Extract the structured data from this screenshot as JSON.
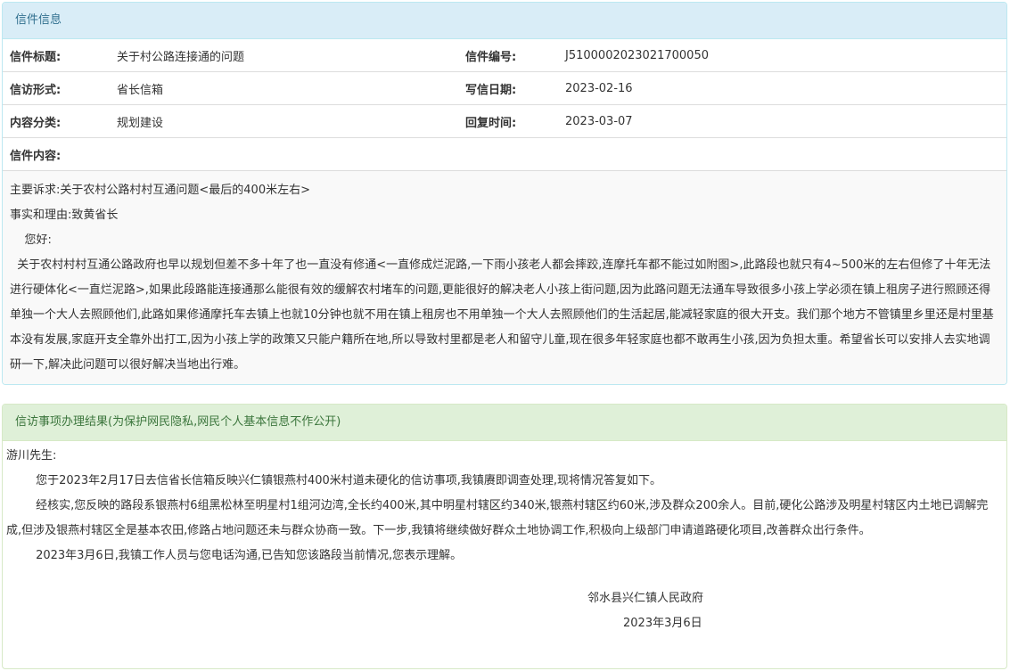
{
  "letter_panel": {
    "title": "信件信息",
    "fields": {
      "subject_label": "信件标题:",
      "subject_value": "关于村公路连接通的问题",
      "number_label": "信件编号:",
      "number_value": "J5100002023021700050",
      "form_label": "信访形式:",
      "form_value": "省长信箱",
      "write_date_label": "写信日期:",
      "write_date_value": "2023-02-16",
      "category_label": "内容分类:",
      "category_value": "规划建设",
      "reply_time_label": "回复时间:",
      "reply_time_value": "2023-03-07",
      "content_label": "信件内容:"
    },
    "content": [
      "主要诉求:关于农村公路村村互通问题<最后的400米左右>",
      "事实和理由:致黄省长",
      "    您好:",
      "  关于农村村村互通公路政府也早以规划但差不多十年了也一直没有修通<一直修成烂泥路,一下雨小孩老人都会摔跤,连摩托车都不能过如附图>,此路段也就只有4~500米的左右但修了十年无法进行硬体化<一直烂泥路>,如果此段路能连接通那么能很有效的缓解农村堵车的问题,更能很好的解决老人小孩上街问题,因为此路问题无法通车导致很多小孩上学必须在镇上租房子进行照顾还得单独一个大人去照顾他们,此路如果修通摩托车去镇上也就10分钟也就不用在镇上租房也不用单独一个大人去照顾他们的生活起居,能减轻家庭的很大开支。我们那个地方不管镇里乡里还是村里基本没有发展,家庭开支全靠外出打工,因为小孩上学的政策又只能户籍所在地,所以导致村里都是老人和留守儿童,现在很多年轻家庭也都不敢再生小孩,因为负担太重。希望省长可以安排人去实地调研一下,解决此问题可以很好解决当地出行难。"
    ]
  },
  "result_panel": {
    "title": "信访事项办理结果(为保护网民隐私,网民个人基本信息不作公开)",
    "paragraphs": [
      "游川先生:",
      "        您于2023年2月17日去信省长信箱反映兴仁镇银燕村400米村道未硬化的信访事项,我镇赓即调查处理,现将情况答复如下。",
      "        经核实,您反映的路段系银燕村6组黑松林至明星村1组河边湾,全长约400米,其中明星村辖区约340米,银燕村辖区约60米,涉及群众200余人。目前,硬化公路涉及明星村辖区内土地已调解完成,但涉及银燕村辖区全是基本农田,修路占地问题还未与群众协商一致。下一步,我镇将继续做好群众土地协调工作,积极向上级部门申请道路硬化项目,改善群众出行条件。",
      "        2023年3月6日,我镇工作人员与您电话沟通,已告知您该路段当前情况,您表示理解。"
    ],
    "signature": "邻水县兴仁镇人民政府",
    "date": "2023年3月6日"
  }
}
